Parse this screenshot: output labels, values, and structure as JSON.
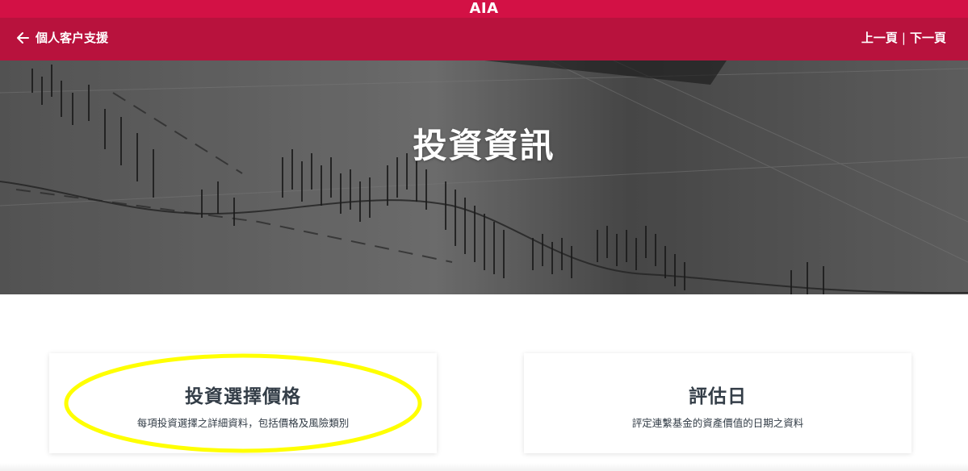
{
  "header": {
    "brand": "AIA",
    "brand_color": "#d31145",
    "nav_color": "#b8123d",
    "back_label": "個人客户支援",
    "prev_label": "上一頁",
    "separator": "|",
    "next_label": "下一頁"
  },
  "hero": {
    "title": "投資資訊",
    "image": "stock-chart-photo"
  },
  "cards": [
    {
      "title": "投資選擇價格",
      "description": "每項投資選擇之詳細資料，包括價格及風險類別",
      "highlighted": true
    },
    {
      "title": "評估日",
      "description": "評定連繫基金的資產價值的日期之資料",
      "highlighted": false
    }
  ],
  "icons": {
    "back": "arrow-left-icon"
  },
  "annotation": {
    "color": "#ffff00",
    "shape": "ellipse"
  }
}
